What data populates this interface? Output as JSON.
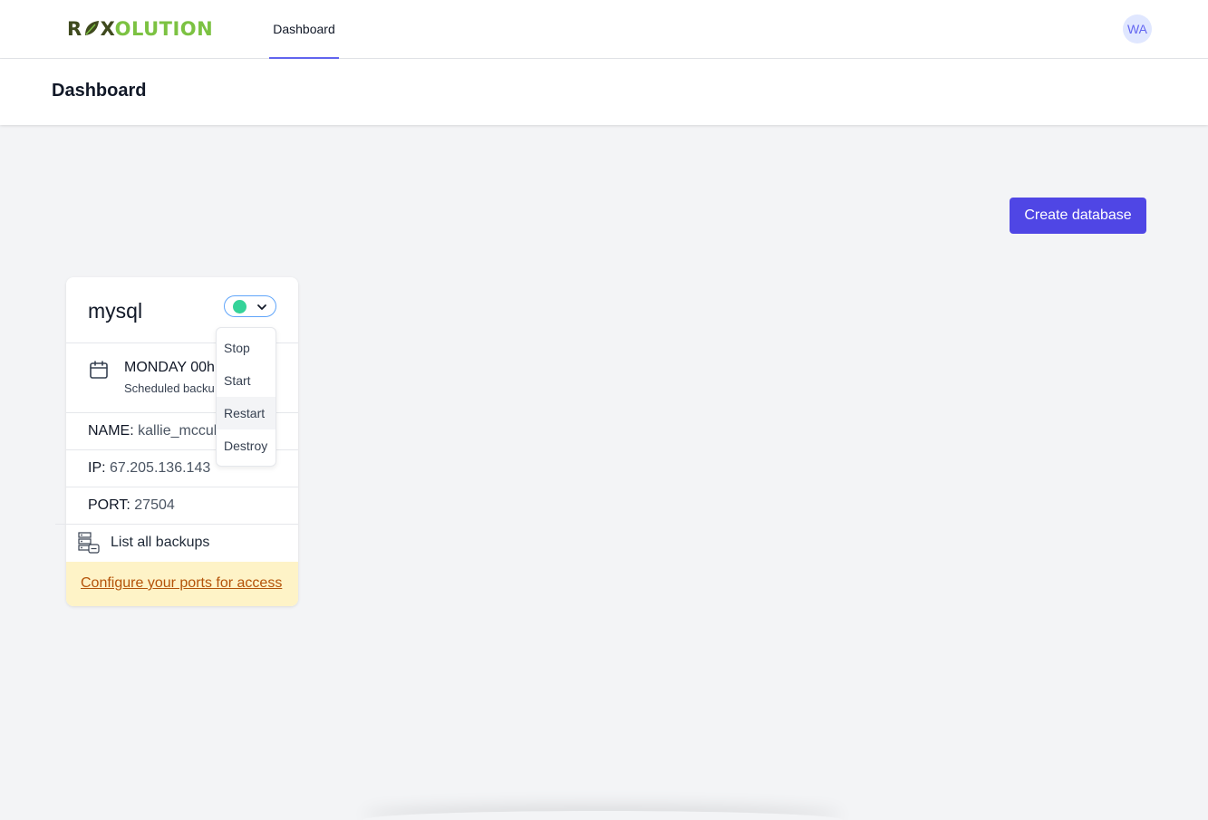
{
  "brand": {
    "logo_part1": "R",
    "logo_part2": "X",
    "logo_part3": "OLUTION",
    "colors": {
      "dark": "#3f4a1e",
      "green": "#7cc242"
    }
  },
  "nav": {
    "tabs": [
      {
        "label": "Dashboard",
        "active": true
      }
    ]
  },
  "user": {
    "initials": "WA"
  },
  "page": {
    "title": "Dashboard"
  },
  "actions": {
    "create_label": "Create database"
  },
  "card": {
    "title": "mysql",
    "status_color": "#34d399",
    "schedule_main": "MONDAY 00h",
    "schedule_sub": "Scheduled backu",
    "name_key": "NAME:",
    "name_value": "kallie_mccul",
    "ip_key": "IP:",
    "ip_value": "67.205.136.143",
    "port_key": "PORT:",
    "port_value": "27504",
    "backups_label": "List all backups",
    "config_label": "Configure your ports for access"
  },
  "dropdown": {
    "items": [
      "Stop",
      "Start",
      "Restart",
      "Destroy"
    ],
    "highlighted": "Restart"
  },
  "colors": {
    "accent": "#4f46e5",
    "nav_underline": "#6366f1",
    "warning_bg": "#fef3c7",
    "warning_text": "#b45309"
  }
}
